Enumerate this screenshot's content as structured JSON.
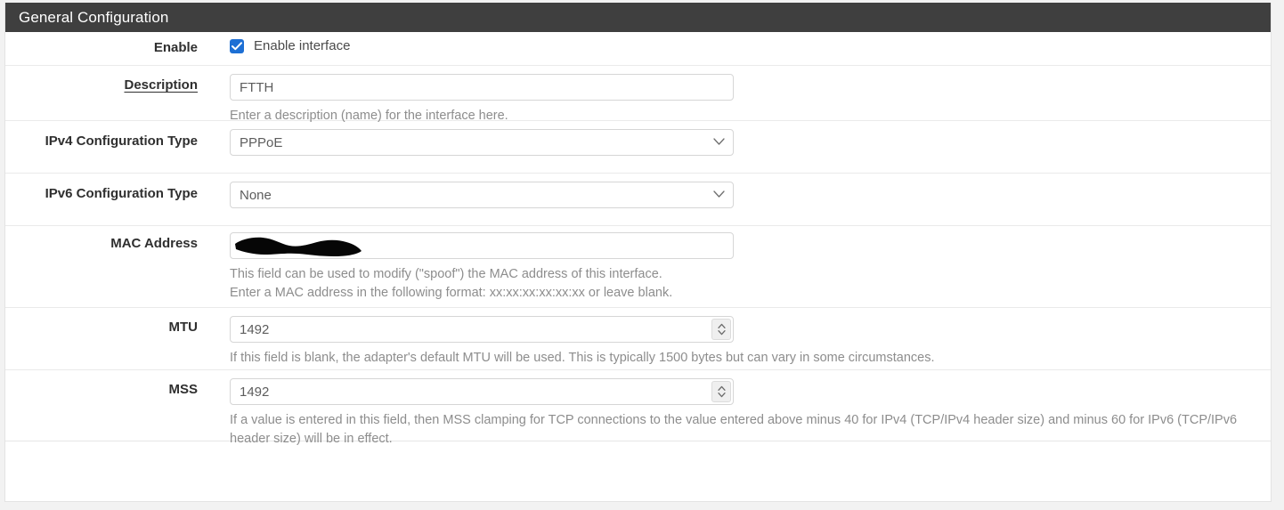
{
  "panel": {
    "title": "General Configuration"
  },
  "rows": {
    "enable": {
      "label": "Enable",
      "checkbox_label": "Enable interface",
      "checked": true,
      "accent_color": "#1d6fd4"
    },
    "description": {
      "label": "Description",
      "value": "FTTH",
      "help": "Enter a description (name) for the interface here."
    },
    "ipv4": {
      "label": "IPv4 Configuration Type",
      "value": "PPPoE",
      "options": [
        "PPPoE"
      ]
    },
    "ipv6": {
      "label": "IPv6 Configuration Type",
      "value": "None",
      "options": [
        "None"
      ]
    },
    "mac": {
      "label": "MAC Address",
      "value": "",
      "redacted": true,
      "help_line1": "This field can be used to modify (\"spoof\") the MAC address of this interface.",
      "help_line2": "Enter a MAC address in the following format: xx:xx:xx:xx:xx:xx or leave blank."
    },
    "mtu": {
      "label": "MTU",
      "value": "1492",
      "help": "If this field is blank, the adapter's default MTU will be used. This is typically 1500 bytes but can vary in some circumstances."
    },
    "mss": {
      "label": "MSS",
      "value": "1492",
      "help_line1": "If a value is entered in this field, then MSS clamping for TCP connections to the value entered above minus 40 for IPv4 (TCP/IPv4 header size) and minus 60 for IPv6 (TCP/IPv6",
      "help_line2": "header size) will be in effect."
    }
  }
}
